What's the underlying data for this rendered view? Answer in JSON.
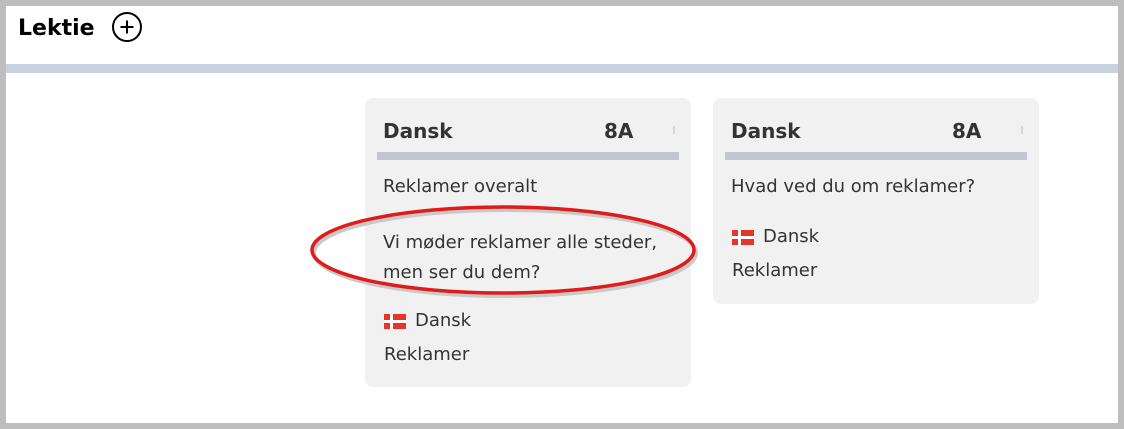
{
  "header": {
    "title": "Lektie",
    "add_icon": "plus-circle-icon"
  },
  "cards": [
    {
      "subject": "Dansk",
      "class": "8A",
      "title": "Reklamer overalt",
      "description": "Vi møder reklamer alle steder, men ser du dem?",
      "language_flag": "flag-denmark-icon",
      "language": "Dansk",
      "tag": "Reklamer"
    },
    {
      "subject": "Dansk",
      "class": "8A",
      "title": "Hvad ved du om reklamer?",
      "language_flag": "flag-denmark-icon",
      "language": "Dansk",
      "tag": "Reklamer"
    }
  ],
  "colors": {
    "header_bar": "#c8d3df",
    "card_background": "#f1f1f1",
    "card_divider": "#c3c5d1",
    "flag_red": "#e8352b",
    "highlight": "#e11a1a"
  }
}
